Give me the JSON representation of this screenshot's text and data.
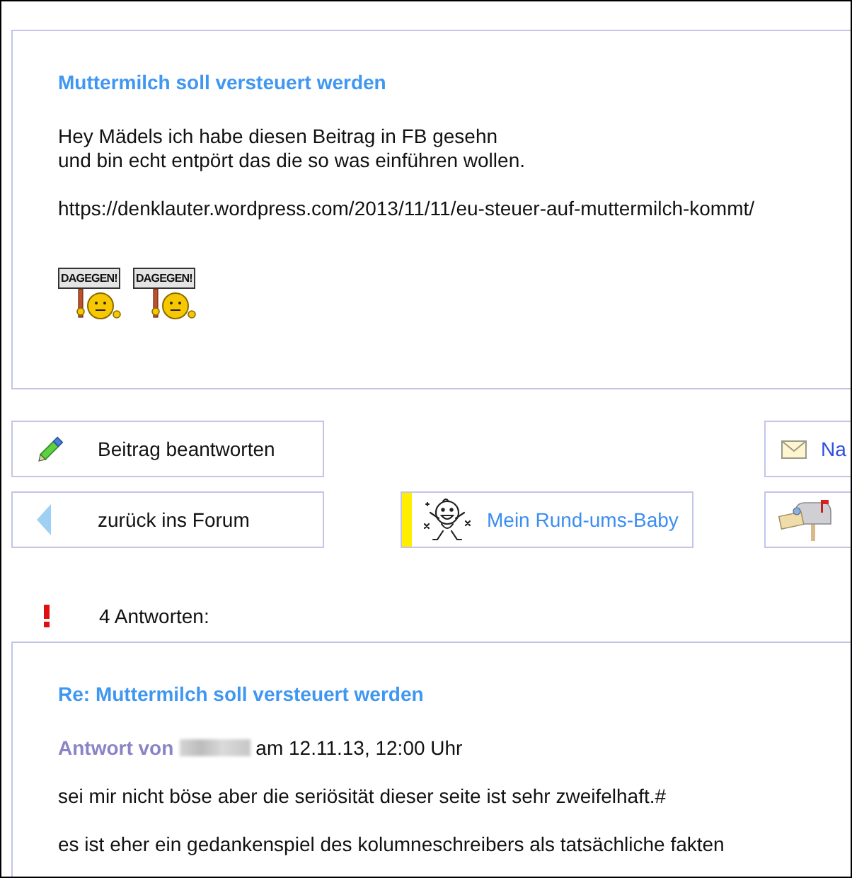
{
  "post": {
    "title": "Muttermilch soll versteuert werden",
    "body": "Hey Mädels ich habe diesen Beitrag in FB gesehn\nund bin echt entpört das die so was einführen wollen.",
    "url": "https://denklauter.wordpress.com/2013/11/11/eu-steuer-auf-muttermilch-kommt/",
    "smileys": [
      {
        "sign": "DAGEGEN!"
      },
      {
        "sign": "DAGEGEN!"
      }
    ]
  },
  "actions": {
    "reply": {
      "label": "Beitrag beantworten"
    },
    "message": {
      "label": "Na"
    },
    "back": {
      "label": "zurück ins Forum"
    },
    "baby": {
      "label": "Mein Rund-ums-Baby"
    }
  },
  "answers": {
    "count": "4 Antworten:"
  },
  "reply": {
    "title": "Re: Muttermilch soll versteuert werden",
    "author_label": "Antwort von",
    "date": "am 12.11.13, 12:00 Uhr",
    "paragraphs": [
      "sei mir nicht böse aber die seriösität dieser seite ist sehr zweifelhaft.#",
      "es ist eher ein gedankenspiel des kolumneschreibers als tatsächliche fakten"
    ]
  }
}
